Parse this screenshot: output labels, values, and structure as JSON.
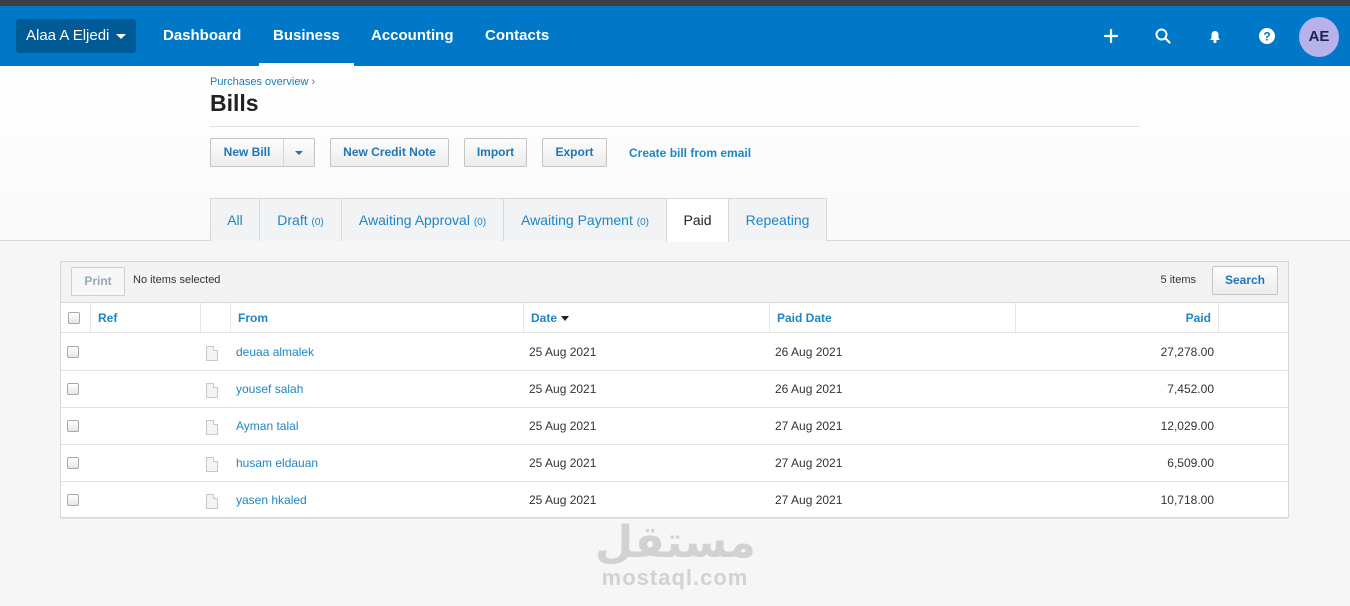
{
  "nav": {
    "org_name": "Alaa A Eljedi",
    "items": [
      "Dashboard",
      "Business",
      "Accounting",
      "Contacts"
    ],
    "active_item": "Business",
    "icons": [
      "plus-icon",
      "search-icon",
      "bell-icon",
      "help-icon"
    ],
    "avatar_initials": "AE",
    "colors": {
      "bar": "#0078c8",
      "avatar": "#b7b2ec"
    }
  },
  "page": {
    "breadcrumb": "Purchases overview",
    "breadcrumb_sep": "›",
    "title": "Bills"
  },
  "actions": {
    "new_bill": "New Bill",
    "new_credit_note": "New Credit Note",
    "import": "Import",
    "export": "Export",
    "create_from_email": "Create bill from email"
  },
  "tabs": [
    {
      "label": "All",
      "count": ""
    },
    {
      "label": "Draft",
      "count": "(0)"
    },
    {
      "label": "Awaiting Approval",
      "count": "(0)"
    },
    {
      "label": "Awaiting Payment",
      "count": "(0)"
    },
    {
      "label": "Paid",
      "count": ""
    },
    {
      "label": "Repeating",
      "count": ""
    }
  ],
  "active_tab": "Paid",
  "toolbar": {
    "print": "Print",
    "selection": "No items selected",
    "items_count": "5 items",
    "search": "Search"
  },
  "table": {
    "headers": {
      "ref": "Ref",
      "from": "From",
      "date": "Date",
      "paid_date": "Paid Date",
      "paid": "Paid"
    },
    "sort_column": "Date",
    "rows": [
      {
        "ref": "",
        "from": "deuaa almalek",
        "date": "25 Aug 2021",
        "paid_date": "26 Aug 2021",
        "paid": "27,278.00"
      },
      {
        "ref": "",
        "from": "yousef salah",
        "date": "25 Aug 2021",
        "paid_date": "26 Aug 2021",
        "paid": "7,452.00"
      },
      {
        "ref": "",
        "from": "Ayman talal",
        "date": "25 Aug 2021",
        "paid_date": "27 Aug 2021",
        "paid": "12,029.00"
      },
      {
        "ref": "",
        "from": "husam eldauan",
        "date": "25 Aug 2021",
        "paid_date": "27 Aug 2021",
        "paid": "6,509.00"
      },
      {
        "ref": "",
        "from": "yasen hkaled",
        "date": "25 Aug 2021",
        "paid_date": "27 Aug 2021",
        "paid": "10,718.00"
      }
    ]
  },
  "watermark": {
    "arabic": "مستقل",
    "latin": "mostaql.com"
  }
}
